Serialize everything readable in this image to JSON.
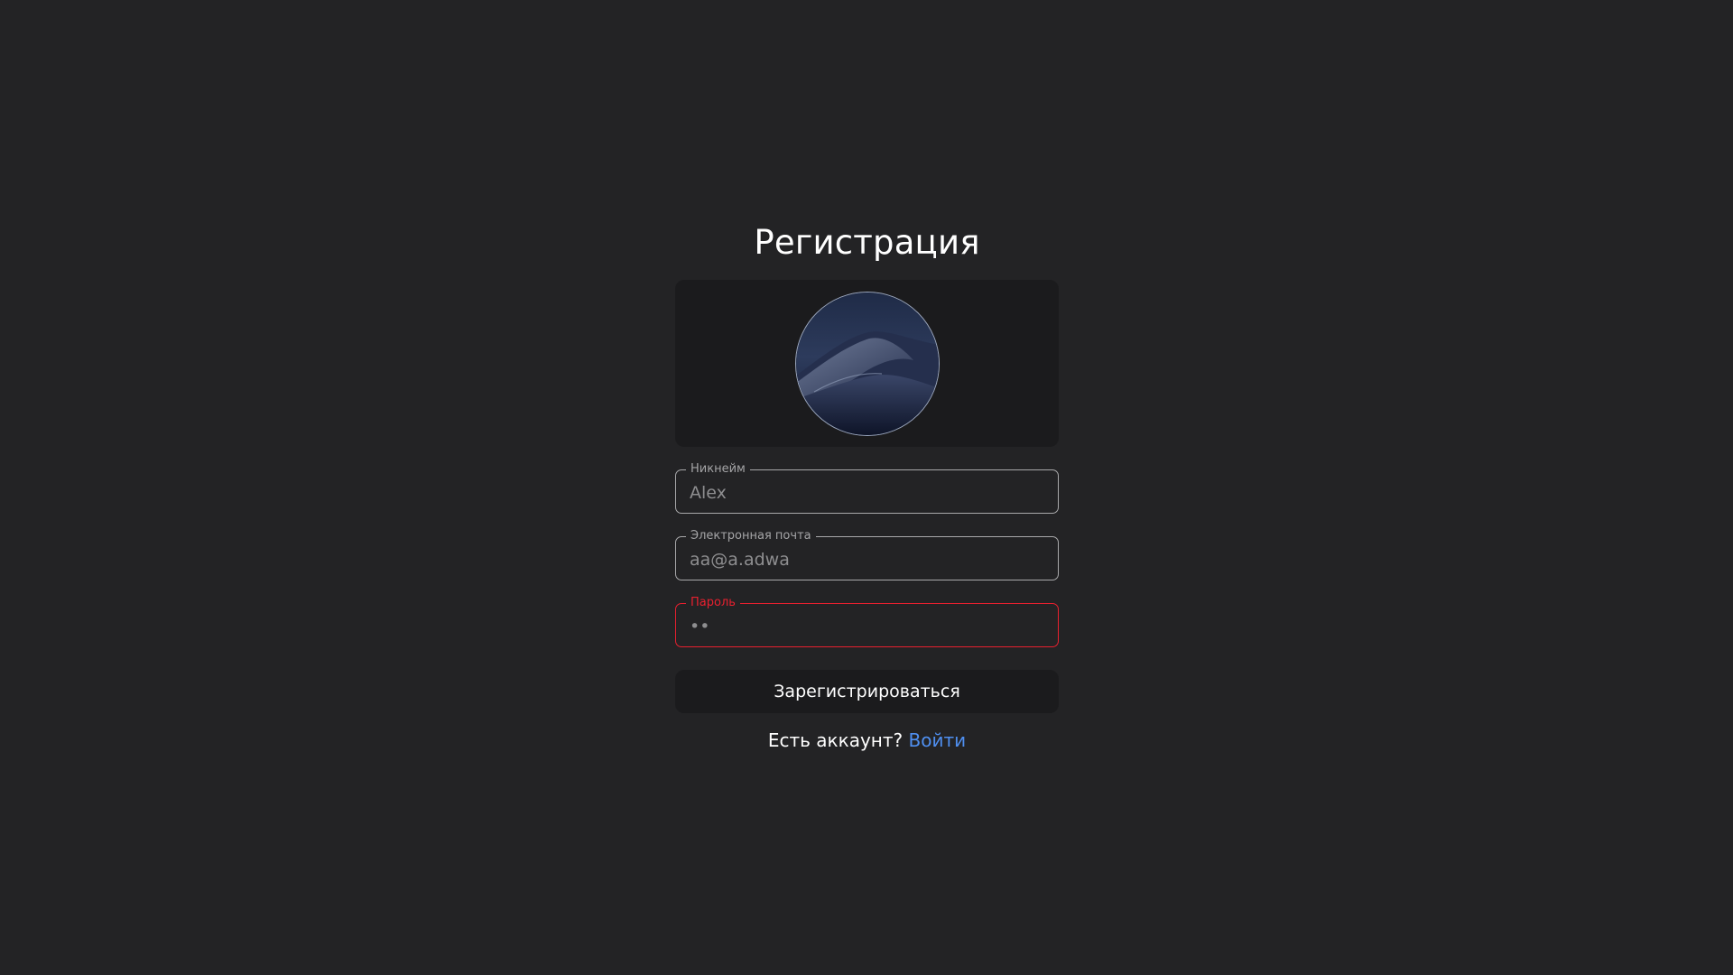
{
  "page": {
    "title": "Регистрация"
  },
  "avatar": {
    "icon": "avatar-image-desert-dunes-night"
  },
  "fields": {
    "nickname": {
      "label": "Никнейм",
      "value": "Alex"
    },
    "email": {
      "label": "Электронная почта",
      "value": "aa@a.adwa"
    },
    "password": {
      "label": "Пароль",
      "value": "12",
      "state": "error"
    }
  },
  "actions": {
    "register_label": "Зарегистрироваться",
    "have_account_text": "Есть аккаунт?",
    "login_link_label": "Войти"
  },
  "colors": {
    "background": "#232325",
    "panel": "#1b1b1d",
    "error": "#e8202f",
    "link": "#4f8ff0",
    "field_border": "#a9a9ab"
  }
}
